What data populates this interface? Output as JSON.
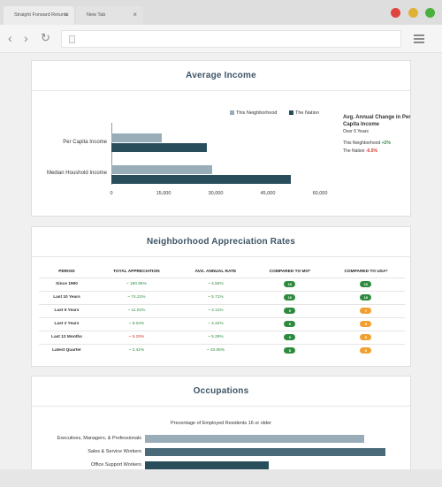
{
  "browser": {
    "tabs": [
      {
        "title": "Straight Forward Returns"
      },
      {
        "title": "New Tab"
      }
    ],
    "close_glyph": "×",
    "traffic_lights": [
      "#e0443e",
      "#dfb135",
      "#4ab03d"
    ],
    "icons": {
      "back": "‹",
      "forward": "›",
      "reload": "↻"
    }
  },
  "income": {
    "title": "Average Income",
    "legend": [
      "This Neighborhood",
      "The Nation"
    ],
    "side_title": "Avg. Annual Change in Per Capita Income",
    "side_subtitle": "Over 5 Years",
    "side_rows": [
      {
        "label": "This Neighborhood",
        "value": "+2%"
      },
      {
        "label": "The Nation",
        "value": "-0.5%"
      }
    ]
  },
  "appreciation": {
    "title": "Neighborhood Appreciation Rates",
    "columns": [
      "PERIOD",
      "TOTAL APPRECIATION",
      "AVG. ANNUAL RATE",
      "COMPARED TO MO*",
      "COMPARED TO USA*"
    ],
    "rows": [
      {
        "period": "Since 1990",
        "total": "~ 190.95%",
        "total_up": true,
        "rate": "~ 4.50%",
        "rate_up": true,
        "mo": "10",
        "mo_color": "#2e8b3e",
        "usa": "10",
        "usa_color": "#2e8b3e"
      },
      {
        "period": "Last 10 Years",
        "total": "~ 74.21%",
        "total_up": true,
        "rate": "~ 5.71%",
        "rate_up": true,
        "mo": "10",
        "mo_color": "#2e8b3e",
        "usa": "10",
        "usa_color": "#2e8b3e"
      },
      {
        "period": "Last 5 Years",
        "total": "~ 11.02%",
        "total_up": true,
        "rate": "~ 2.11%",
        "rate_up": true,
        "mo": "9",
        "mo_color": "#2e8b3e",
        "usa": "7",
        "usa_color": "#f0a030"
      },
      {
        "period": "Last 2 Years",
        "total": "~ 9.04%",
        "total_up": true,
        "rate": "~ 4.42%",
        "rate_up": true,
        "mo": "9",
        "mo_color": "#2e8b3e",
        "usa": "6",
        "usa_color": "#f0a030"
      },
      {
        "period": "Last 12 Months",
        "total": "~ 5.29%",
        "total_up": false,
        "rate": "~ 5.29%",
        "rate_up": true,
        "mo": "9",
        "mo_color": "#2e8b3e",
        "usa": "6",
        "usa_color": "#f0a030"
      },
      {
        "period": "Latest Quarter",
        "total": "~ 2.42%",
        "total_up": true,
        "rate": "~ 10.06%",
        "rate_up": true,
        "mo": "8",
        "mo_color": "#2e8b3e",
        "usa": "6",
        "usa_color": "#f0a030"
      }
    ]
  },
  "occupations": {
    "title": "Occupations",
    "subtitle": "Precentage of Employed Residents 16 or older"
  },
  "chart_data": [
    {
      "type": "bar",
      "orientation": "horizontal",
      "categories": [
        "Per Capita Income",
        "Median Houshold Income"
      ],
      "series": [
        {
          "name": "This Neighborhood",
          "color": "#98adb8",
          "values": [
            14500,
            29000
          ]
        },
        {
          "name": "The Nation",
          "color": "#294d5b",
          "values": [
            27500,
            51500
          ]
        }
      ],
      "xticks": [
        "0",
        "15,000",
        "30,000",
        "45,000",
        "60,000"
      ],
      "xlim": [
        0,
        60000
      ],
      "legend": "top"
    },
    {
      "type": "bar",
      "orientation": "horizontal",
      "title": "Precentage of Employed Residents 16 or older",
      "categories": [
        "Executives, Managers, & Professionals",
        "Sales & Service Workers",
        "Office Support Workers"
      ],
      "values": [
        30,
        33,
        17
      ],
      "colors": [
        "#98adb8",
        "#4a6a7a",
        "#294d5b"
      ],
      "xlim": [
        0,
        40
      ]
    }
  ]
}
